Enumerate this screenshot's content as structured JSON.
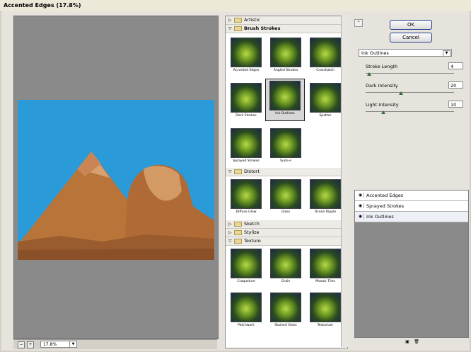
{
  "window": {
    "title": "Accented Edges (17.8%)"
  },
  "preview": {
    "zoom_value": "17.8%",
    "zoom_out": "−",
    "zoom_in": "+"
  },
  "gallery": {
    "categories": [
      {
        "name": "Artistic",
        "open": false
      },
      {
        "name": "Brush Strokes",
        "open": true,
        "filters": [
          "Accented Edges",
          "Angled Strokes",
          "Crosshatch",
          "Dark Strokes",
          "Ink Outlines",
          "Spatter",
          "Sprayed Strokes",
          "Sumi-e"
        ]
      },
      {
        "name": "Distort",
        "open": true,
        "filters": [
          "Diffuse Glow",
          "Glass",
          "Ocean Ripple"
        ]
      },
      {
        "name": "Sketch",
        "open": false
      },
      {
        "name": "Stylize",
        "open": false
      },
      {
        "name": "Texture",
        "open": true,
        "filters": [
          "Craquelure",
          "Grain",
          "Mosaic Tiles",
          "Patchwork",
          "Stained Glass",
          "Texturizer"
        ]
      }
    ],
    "selected": "Ink Outlines"
  },
  "buttons": {
    "ok": "OK",
    "cancel": "Cancel"
  },
  "filter_select": {
    "value": "Ink Outlines"
  },
  "params": [
    {
      "label": "Stroke Length",
      "value": "4",
      "fraction": 0.04
    },
    {
      "label": "Dark Intensity",
      "value": "20",
      "fraction": 0.4
    },
    {
      "label": "Light Intensity",
      "value": "10",
      "fraction": 0.2
    }
  ],
  "layers": [
    "Accented Edges",
    "Sprayed Strokes",
    "Ink Outlines"
  ],
  "icons": {
    "collapse": "chevron-up-icon",
    "new_layer": "new-layer-icon",
    "delete_layer": "trash-icon",
    "eye": "eye-icon"
  }
}
